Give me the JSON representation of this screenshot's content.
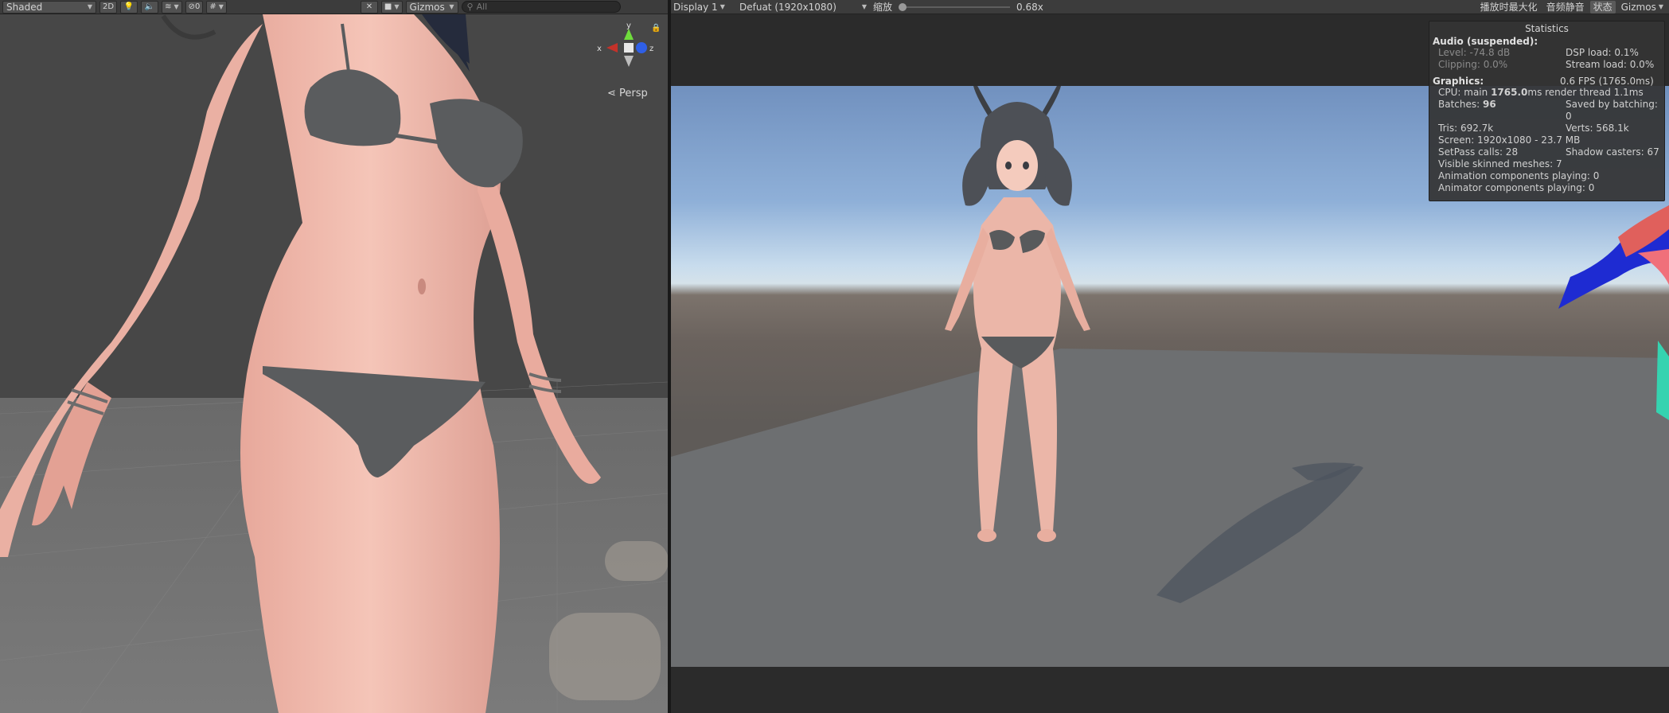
{
  "scene": {
    "toolbar": {
      "draw_mode": "Shaded",
      "mode_2d": "2D",
      "hidden_count": "0",
      "gizmos": "Gizmos",
      "search_placeholder": "All"
    },
    "axes": {
      "y": "y",
      "x": "x",
      "z": "z"
    },
    "projection": "Persp"
  },
  "game": {
    "toolbar": {
      "display": "Display 1",
      "resolution": "Defuat (1920x1080)",
      "scale_label": "缩放",
      "scale_value": "0.68x",
      "scale_fraction": 0.0,
      "maximize_on_play": "播放时最大化",
      "mute_audio": "音频静音",
      "stats": "状态",
      "gizmos": "Gizmos"
    }
  },
  "stats": {
    "title": "Statistics",
    "audio_header": "Audio (suspended):",
    "level": "Level: -74.8 dB",
    "dsp_load": "DSP load: 0.1%",
    "clipping": "Clipping: 0.0%",
    "stream_load": "Stream load: 0.0%",
    "graphics_header": "Graphics:",
    "fps": "0.6 FPS (1765.0ms)",
    "cpu_prefix": "CPU: main ",
    "cpu_main": "1765.0",
    "cpu_suffix": "ms  render thread 1.1ms",
    "batches_prefix": "Batches: ",
    "batches": "96",
    "saved_by_batching": "Saved by batching: 0",
    "tris": "Tris: 692.7k",
    "verts": "Verts: 568.1k",
    "screen": "Screen: 1920x1080 - 23.7 MB",
    "setpass": "SetPass calls: 28",
    "shadow_casters": "Shadow casters: 67",
    "skinned_meshes": "Visible skinned meshes: 7",
    "animation_components": "Animation components playing: 0",
    "animator_components": "Animator components playing: 0"
  }
}
